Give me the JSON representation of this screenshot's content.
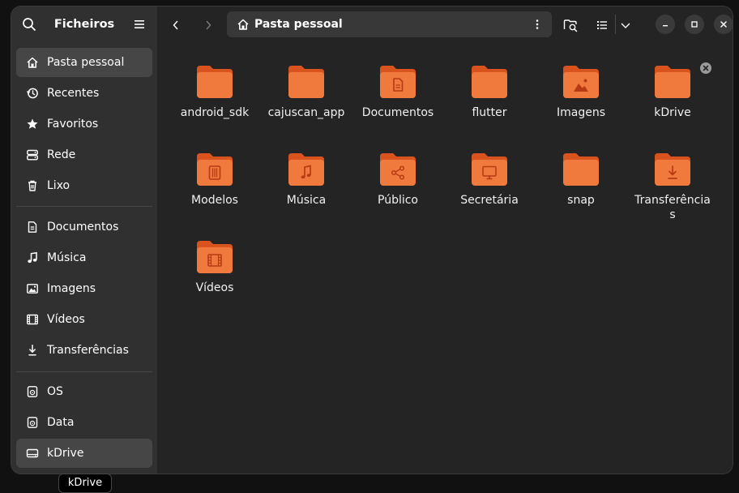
{
  "sidebar": {
    "title": "Ficheiros",
    "places": [
      {
        "label": "Pasta pessoal",
        "icon": "home-icon"
      },
      {
        "label": "Recentes",
        "icon": "clock-icon"
      },
      {
        "label": "Favoritos",
        "icon": "star-icon"
      },
      {
        "label": "Rede",
        "icon": "network-icon"
      },
      {
        "label": "Lixo",
        "icon": "trash-icon"
      }
    ],
    "bookmarks": [
      {
        "label": "Documentos",
        "icon": "document-icon"
      },
      {
        "label": "Música",
        "icon": "music-icon"
      },
      {
        "label": "Imagens",
        "icon": "image-icon"
      },
      {
        "label": "Vídeos",
        "icon": "video-icon"
      },
      {
        "label": "Transferências",
        "icon": "download-icon"
      }
    ],
    "devices": [
      {
        "label": "OS",
        "icon": "drive-icon"
      },
      {
        "label": "Data",
        "icon": "drive-icon"
      },
      {
        "label": "kDrive",
        "icon": "drive-icon"
      }
    ]
  },
  "pathbar": {
    "current": "Pasta pessoal"
  },
  "folders": [
    {
      "name": "android_sdk",
      "emblem": "none"
    },
    {
      "name": "cajuscan_app",
      "emblem": "none"
    },
    {
      "name": "Documentos",
      "emblem": "document"
    },
    {
      "name": "flutter",
      "emblem": "none"
    },
    {
      "name": "Imagens",
      "emblem": "image"
    },
    {
      "name": "kDrive",
      "emblem": "none"
    },
    {
      "name": "Modelos",
      "emblem": "template"
    },
    {
      "name": "Música",
      "emblem": "music"
    },
    {
      "name": "Público",
      "emblem": "share"
    },
    {
      "name": "Secretária",
      "emblem": "desktop"
    },
    {
      "name": "snap",
      "emblem": "none"
    },
    {
      "name": "Transferências",
      "emblem": "download"
    },
    {
      "name": "Vídeos",
      "emblem": "video"
    }
  ],
  "tooltip": "kDrive",
  "colors": {
    "folder_front": "#F07A3E",
    "folder_back": "#D9531F",
    "emblem": "#B83A12",
    "sidebar_bg": "#303030",
    "main_bg": "#242424"
  }
}
